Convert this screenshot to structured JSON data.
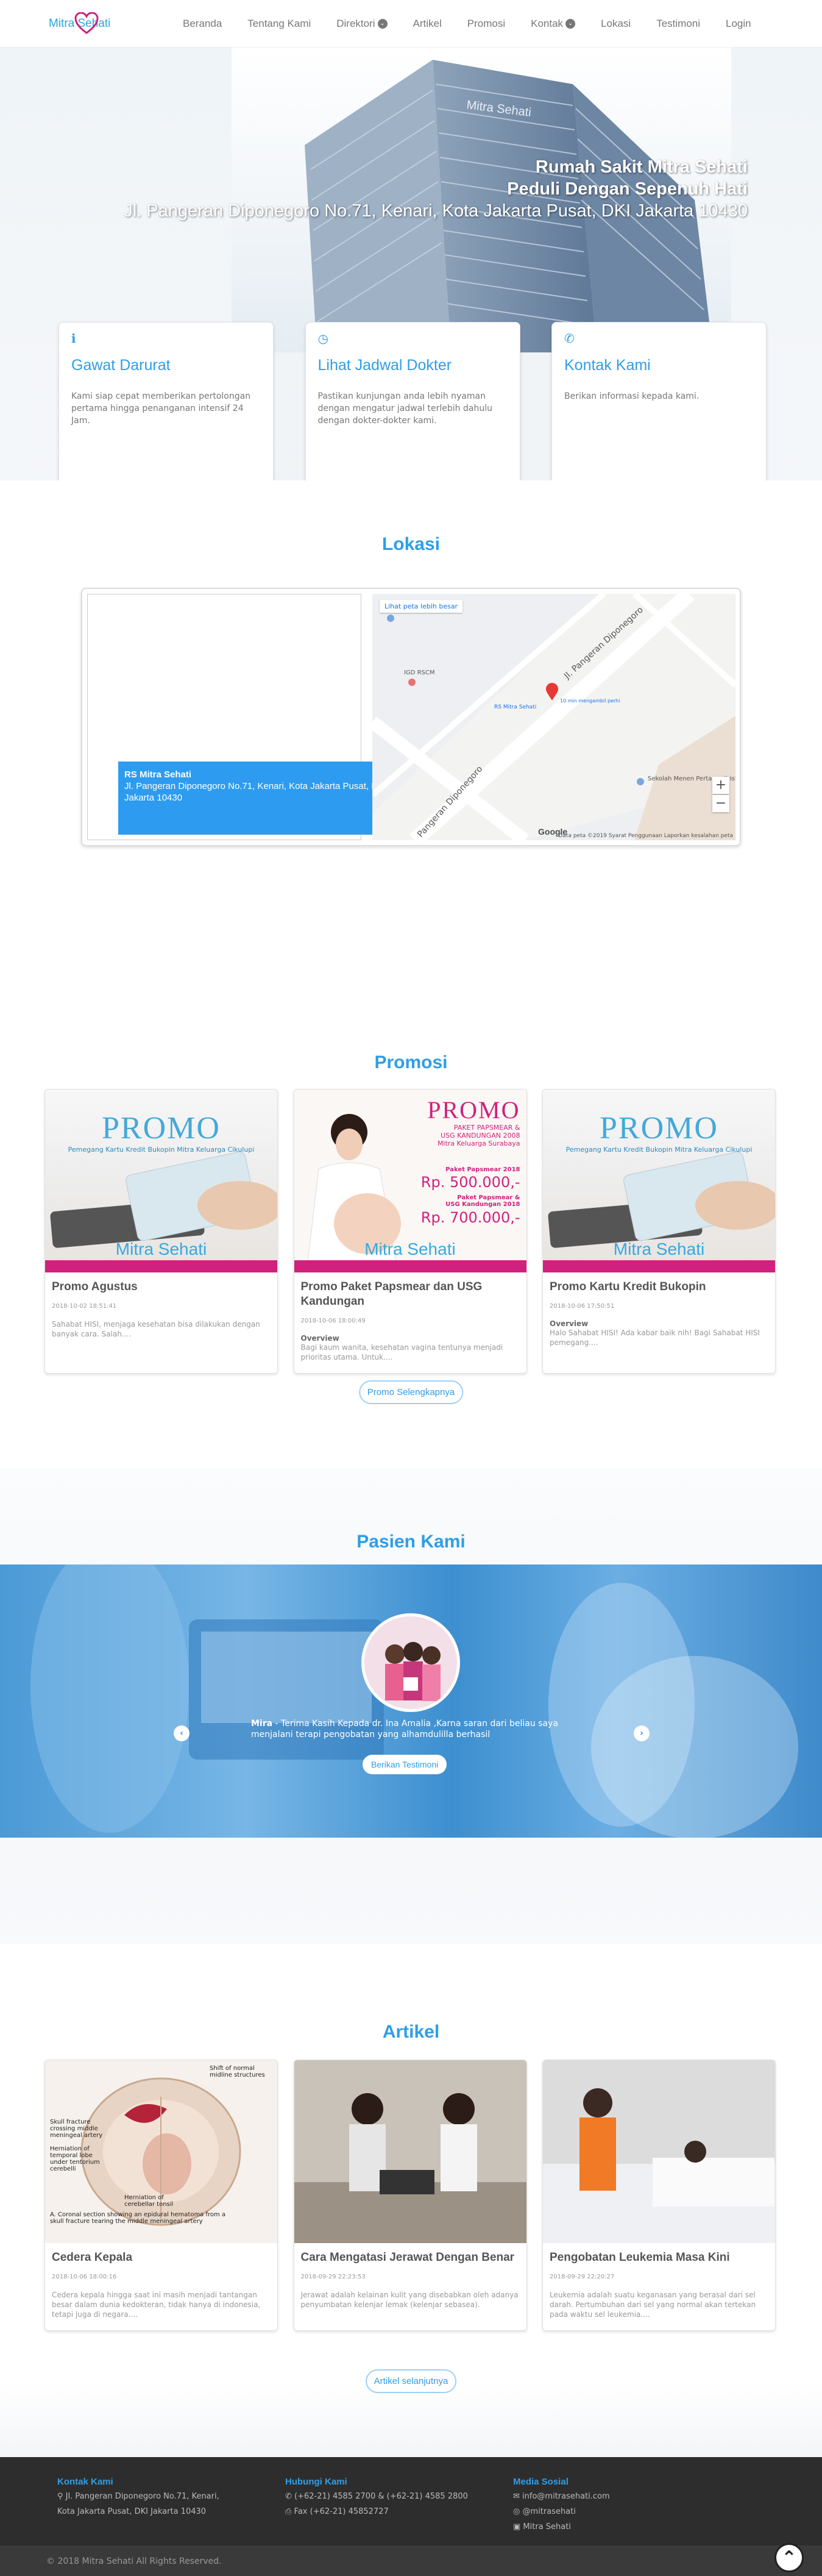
{
  "nav": {
    "logo": "Mitra Sehati",
    "items": [
      {
        "label": "Beranda",
        "caret": false
      },
      {
        "label": "Tentang Kami",
        "caret": false
      },
      {
        "label": "Direktori",
        "caret": true
      },
      {
        "label": "Artikel",
        "caret": false
      },
      {
        "label": "Promosi",
        "caret": false
      },
      {
        "label": "Kontak",
        "caret": true
      },
      {
        "label": "Lokasi",
        "caret": false
      },
      {
        "label": "Testimoni",
        "caret": false
      },
      {
        "label": "Login",
        "caret": false
      }
    ]
  },
  "hero": {
    "title": "Rumah Sakit Mitra Sehati",
    "tagline": "Peduli Dengan Sepenuh Hati",
    "address": "Jl. Pangeran Diponegoro No.71, Kenari, Kota Jakarta Pusat, DKI Jakarta 10430",
    "building_sign": "Mitra Sehati"
  },
  "features": [
    {
      "icon": "info-icon",
      "glyph": "ℹ",
      "title": "Gawat Darurat",
      "text": "Kami siap cepat memberikan pertolongan pertama hingga penanganan intensif 24 Jam."
    },
    {
      "icon": "clock-icon",
      "glyph": "◷",
      "title": "Lihat Jadwal Dokter",
      "text": "Pastikan kunjungan anda lebih nyaman dengan mengatur jadwal terlebih dahulu dengan dokter-dokter kami."
    },
    {
      "icon": "phone-icon",
      "glyph": "✆",
      "title": "Kontak Kami",
      "text": "Berikan informasi kepada kami."
    }
  ],
  "lokasi": {
    "title": "Lokasi",
    "info_name": "RS Mitra Sehati",
    "info_address": "Jl. Pangeran Diponegoro No.71, Kenari, Kota Jakarta Pusat, DKI Jakarta 10430",
    "map_link": "Lihat peta lebih besar",
    "street1": "Jl. Pangeran Diponegoro",
    "street2": "Pangeran Diponegoro",
    "place_igd": "IGD RSCM",
    "place_rs": "RS Mitra Sehati",
    "place_hint": "10 min mengambil perhi",
    "place_school": "Sekolah Menen Pertama Kriste",
    "google": "Google",
    "foot": "Data peta ©2019   Syarat Penggunaan   Laporkan kesalahan peta"
  },
  "promosi": {
    "title": "Promosi",
    "button": "Promo Selengkapnya",
    "cards": [
      {
        "title": "Promo Agustus",
        "date": "2018-10-02 18:51:41",
        "overview": "",
        "text": "Sahabat HISI, menjaga kesehatan bisa dilakukan dengan banyak cara. Salah....",
        "img": {
          "variant": "card",
          "promo": "PROMO",
          "sub": "Pemegang Kartu Kredit Bukopin\nMitra Keluarga Cikulupi",
          "brand": "Mitra Sehati"
        }
      },
      {
        "title": "Promo Paket Papsmear dan USG Kandungan",
        "date": "2018-10-06 18:00:49",
        "overview": "Overview",
        "text": "Bagi kaum wanita, kesehatan vagina tentunya menjadi prioritas utama. Untuk....",
        "img": {
          "variant": "woman",
          "promo": "PROMO",
          "sub": "PAKET PAPSMEAR &\nUSG KANDUNGAN 2008\nMitra Keluarga Surabaya",
          "price1_label": "Paket Papsmear 2018",
          "price1": "Rp. 500.000,-",
          "price2_label": "Paket Papsmear & USG Kandungan 2018",
          "price2": "Rp. 700.000,-",
          "brand": "Mitra Sehati"
        }
      },
      {
        "title": "Promo Kartu Kredit Bukopin",
        "date": "2018-10-06 17:50:51",
        "overview": "Overview",
        "text": "Halo Sahabat HISI! Ada kabar baik nih! Bagi Sahabat HISI pemegang....",
        "img": {
          "variant": "card",
          "promo": "PROMO",
          "sub": "Pemegang Kartu Kredit Bukopin\nMitra Keluarga Cikulupi",
          "brand": "Mitra Sehati"
        }
      }
    ]
  },
  "pasien": {
    "title": "Pasien Kami",
    "name": "Mira",
    "quote": " - Terima Kasih Kepada dr. Ina Amalia ,Karna saran dari beliau saya menjalani terapi pengobatan yang alhamdulilla berhasil",
    "button": "Berikan Testimoni",
    "prev": "‹",
    "next": "›"
  },
  "artikel": {
    "title": "Artikel",
    "button": "Artikel selanjutnya",
    "cards": [
      {
        "title": "Cedera Kepala",
        "date": "2018-10-06 18:00:16",
        "text": "Cedera kepala hingga saat ini masih menjadi tantangan besar dalam dunia kedokteran, tidak hanya di indonesia, tetapi juga di negara....",
        "img_labels": [
          "Skull fracture crossing middle meningeal artery",
          "Shift of normal midline structures",
          "Herniation of temporal lobe under tentorium cerebelli",
          "Herniation of cerebellar tonsil",
          "A. Coronal section showing an epidural hematoma from a skull fracture tearing the middle meningeal artery"
        ]
      },
      {
        "title": "Cara Mengatasi Jerawat Dengan Benar",
        "date": "2018-09-29 22:23:53",
        "text": "Jerawat adalah kelainan kulit yang disebabkan oleh adanya penyumbatan kelenjar lemak (kelenjar sebasea).",
        "img_labels": []
      },
      {
        "title": "Pengobatan Leukemia Masa Kini",
        "date": "2018-09-29 22:20:27",
        "text": "Leukemia adalah suatu keganasan yang berasal dari sel darah. Pertumbuhan dari sel yang normal akan tertekan pada waktu sel leukemia....",
        "img_labels": []
      }
    ]
  },
  "footer": {
    "kontak_title": "Kontak Kami",
    "kontak_address1": "Jl. Pangeran Diponegoro No.71, Kenari,",
    "kontak_address2": "Kota Jakarta Pusat, DKI Jakarta 10430",
    "hubungi_title": "Hubungi Kami",
    "phone": "(+62-21) 4585 2700 & (+62-21) 4585 2800",
    "fax": "Fax (+62-21) 45852727",
    "sosial_title": "Media Sosial",
    "email": "info@mitrasehati.com",
    "instagram": "@mitrasehati",
    "facebook": "Mitra Sehati",
    "copyright": "© 2018 Mitra Sehati All Rights Reserved.",
    "totop": "⌃"
  },
  "colors": {
    "accent": "#2f9ee6",
    "pink": "#d0217e",
    "footer": "#2d2d2d"
  }
}
